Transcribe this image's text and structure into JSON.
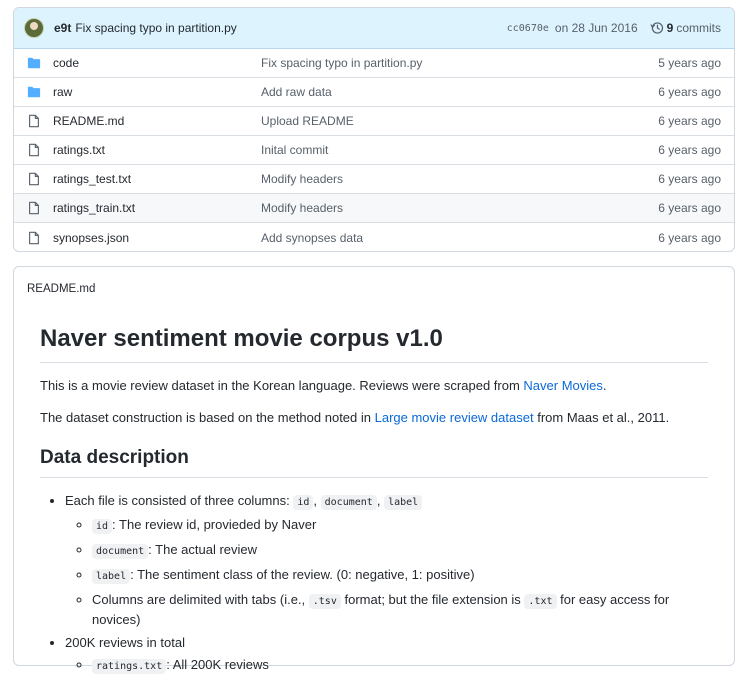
{
  "commit": {
    "author": "e9t",
    "message": "Fix spacing typo in partition.py",
    "sha": "cc0670e",
    "date": "on 28 Jun 2016",
    "count": "9",
    "count_label": "commits"
  },
  "files": [
    {
      "type": "folder",
      "name": "code",
      "message": "Fix spacing typo in partition.py",
      "age": "5 years ago"
    },
    {
      "type": "folder",
      "name": "raw",
      "message": "Add raw data",
      "age": "6 years ago"
    },
    {
      "type": "file",
      "name": "README.md",
      "message": "Upload README",
      "age": "6 years ago"
    },
    {
      "type": "file",
      "name": "ratings.txt",
      "message": "Inital commit",
      "age": "6 years ago"
    },
    {
      "type": "file",
      "name": "ratings_test.txt",
      "message": "Modify headers",
      "age": "6 years ago"
    },
    {
      "type": "file",
      "name": "ratings_train.txt",
      "message": "Modify headers",
      "age": "6 years ago"
    },
    {
      "type": "file",
      "name": "synopses.json",
      "message": "Add synopses data",
      "age": "6 years ago"
    }
  ],
  "readme": {
    "filename": "README.md",
    "title": "Naver sentiment movie corpus v1.0",
    "p1_text": "This is a movie review dataset in the Korean language. Reviews were scraped from ",
    "p1_link": "Naver Movies",
    "p1_end": ".",
    "p2_text": "The dataset construction is based on the method noted in ",
    "p2_link": "Large movie review dataset",
    "p2_end": " from Maas et al., 2011.",
    "h2": "Data description",
    "li1_text": "Each file is consisted of three columns: ",
    "li1_code1": "id",
    "li1_code2": "document",
    "li1_code3": "label",
    "sep": ",",
    "sub1_code": "id",
    "sub1_text": ": The review id, provieded by Naver",
    "sub2_code": "document",
    "sub2_text": ": The actual review",
    "sub3_code": "label",
    "sub3_text": ": The sentiment class of the review. (0: negative, 1: positive)",
    "sub4_a": "Columns are delimited with tabs (i.e., ",
    "sub4_code1": ".tsv",
    "sub4_b": " format; but the file extension is ",
    "sub4_code2": ".txt",
    "sub4_c": " for easy access for novices)",
    "li2_text": "200K reviews in total",
    "li2_sub_code": "ratings.txt",
    "li2_sub_text": ": All 200K reviews"
  },
  "colors": {
    "accent": "#0969da",
    "commit_bar": "#ddf4ff",
    "folder": "#54aeff",
    "border": "#d0d7de"
  }
}
